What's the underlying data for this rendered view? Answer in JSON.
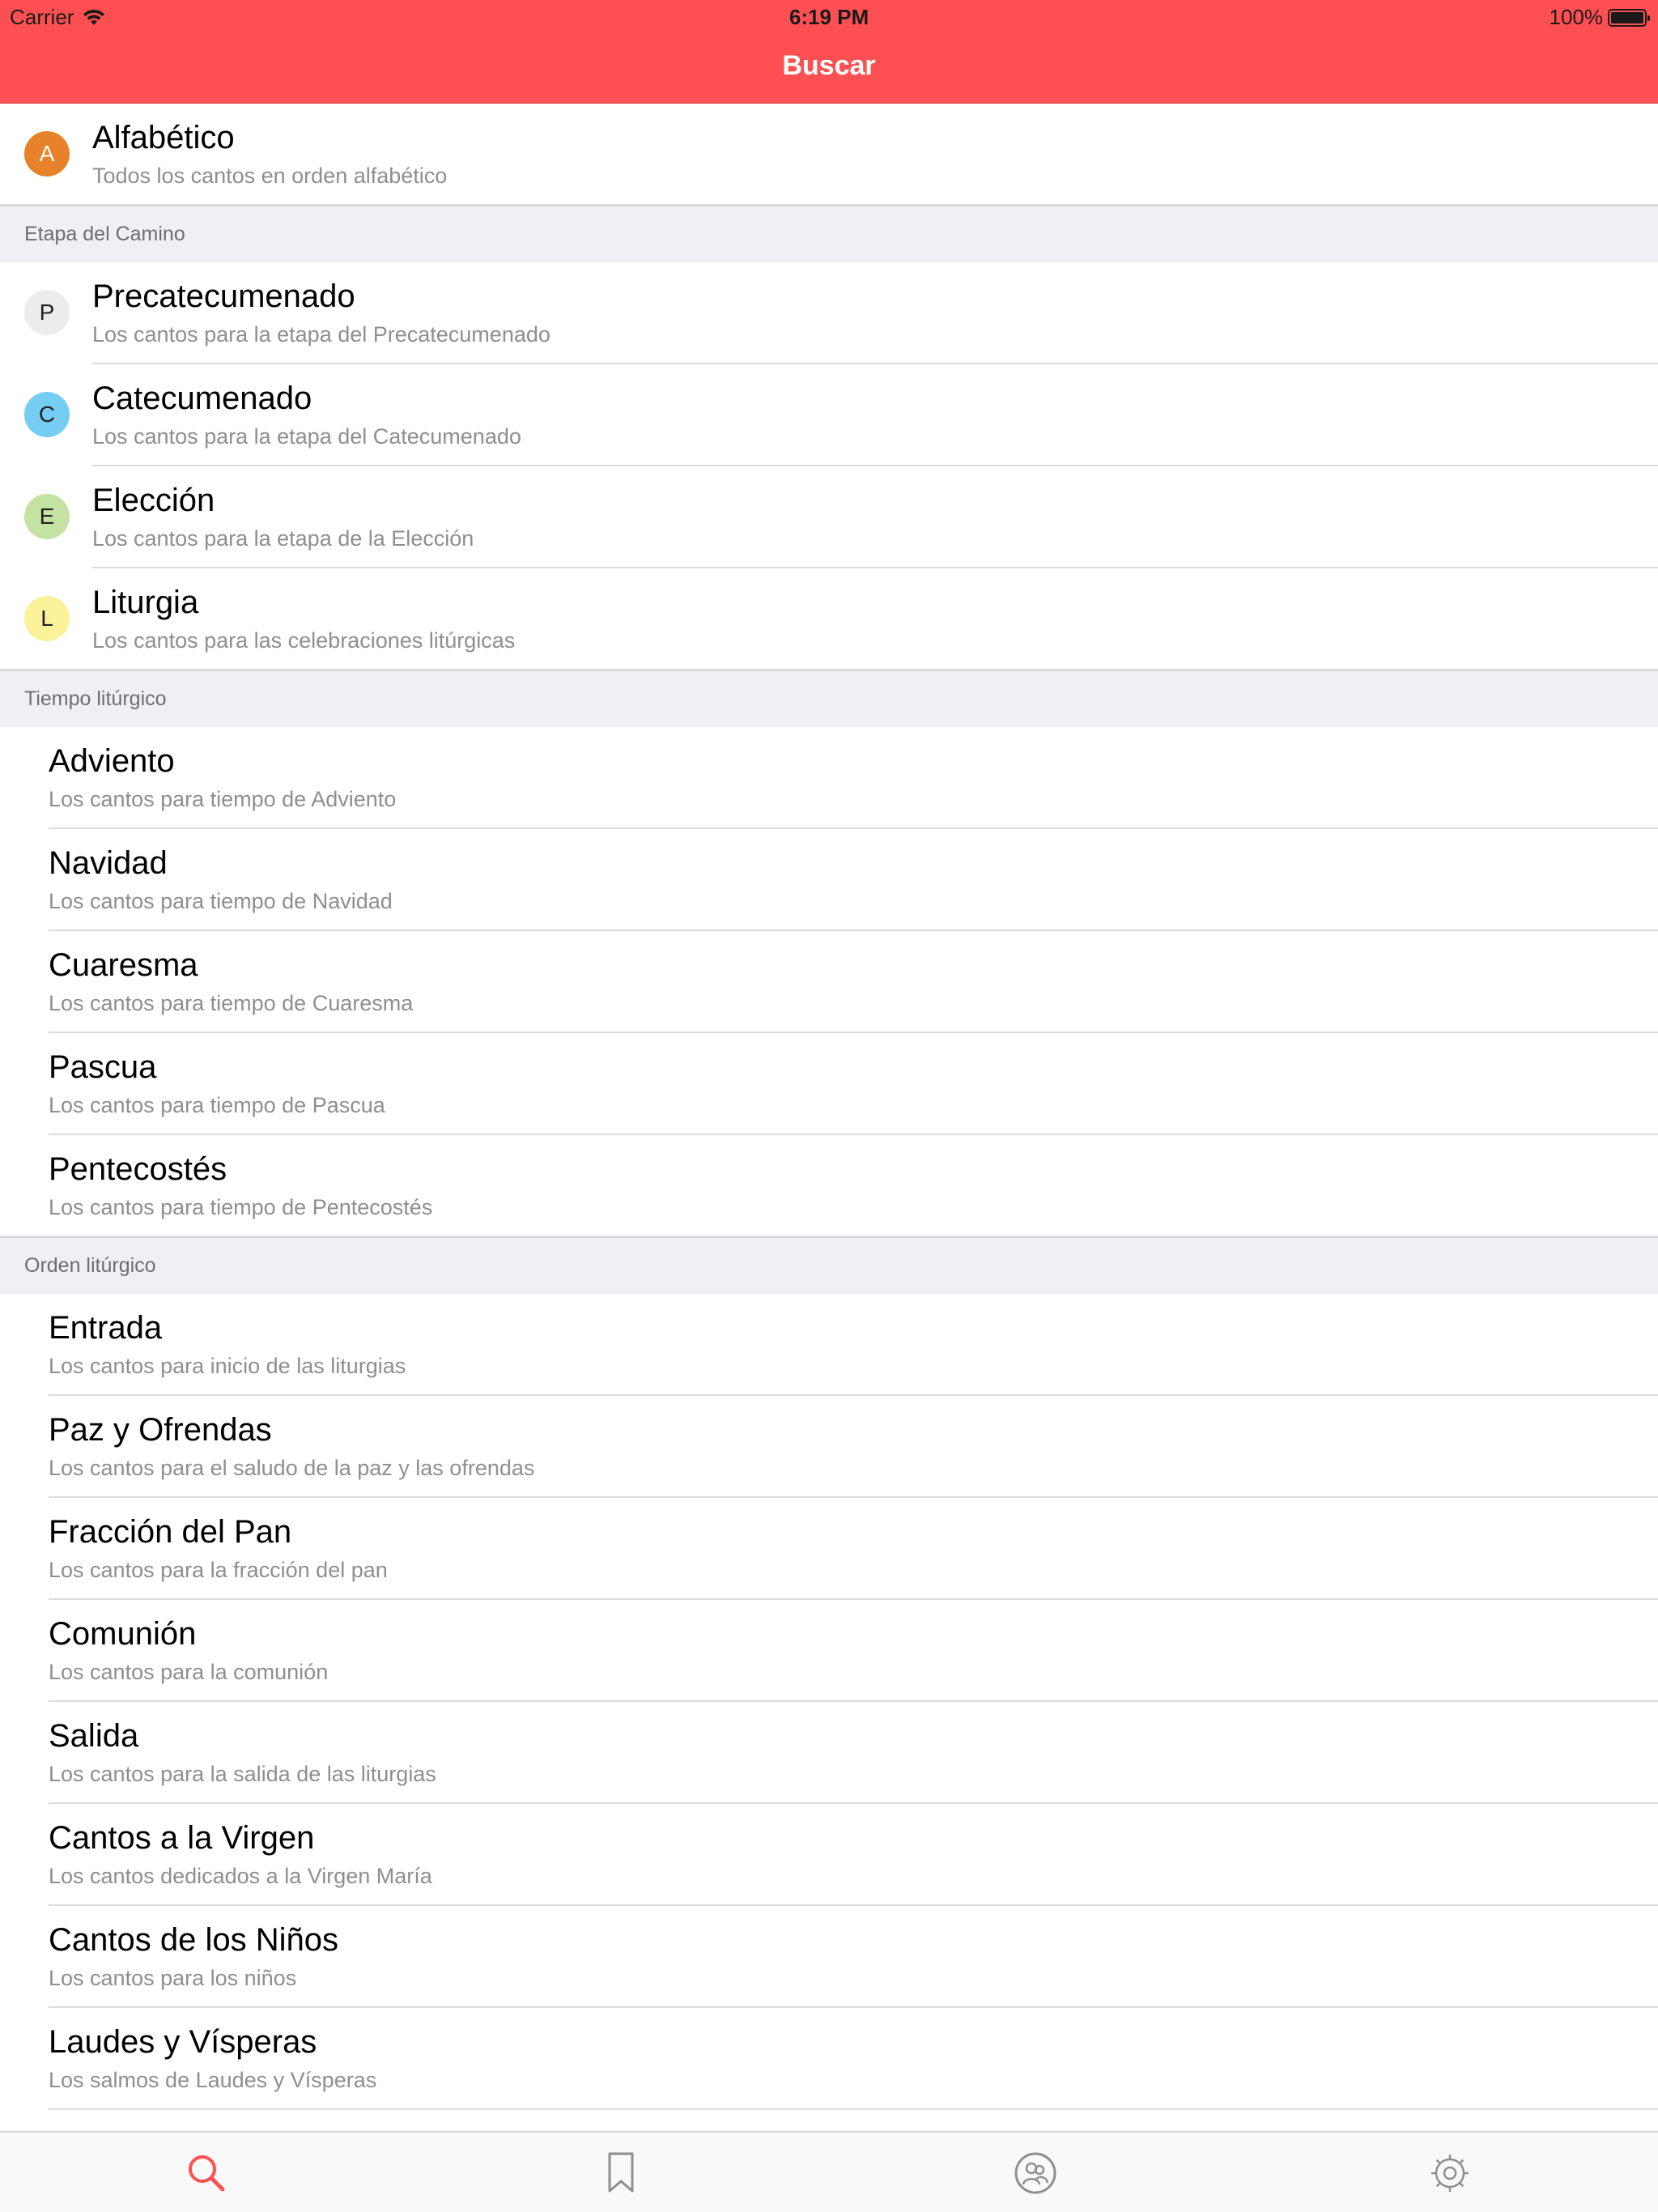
{
  "status_bar": {
    "carrier": "Carrier",
    "time": "6:19 PM",
    "battery": "100%"
  },
  "nav": {
    "title": "Buscar"
  },
  "colors": {
    "accent": "#fe5052",
    "badge_a": "#e8822a",
    "badge_p": "#ececec",
    "badge_c": "#76cdf3",
    "badge_e": "#c4e3a3",
    "badge_l": "#fcf29a",
    "section_bg": "#efeff4"
  },
  "alphabetical": {
    "badge": "A",
    "title": "Alfabético",
    "subtitle": "Todos los cantos en orden alfabético"
  },
  "etapa": {
    "header": "Etapa del Camino",
    "items": [
      {
        "badge": "P",
        "title": "Precatecumenado",
        "subtitle": "Los cantos para la etapa del Precatecumenado"
      },
      {
        "badge": "C",
        "title": "Catecumenado",
        "subtitle": "Los cantos para la etapa del Catecumenado"
      },
      {
        "badge": "E",
        "title": "Elección",
        "subtitle": "Los cantos para la etapa de la Elección"
      },
      {
        "badge": "L",
        "title": "Liturgia",
        "subtitle": "Los cantos para las celebraciones litúrgicas"
      }
    ]
  },
  "tiempo": {
    "header": "Tiempo litúrgico",
    "items": [
      {
        "title": "Adviento",
        "subtitle": "Los cantos para tiempo de Adviento"
      },
      {
        "title": "Navidad",
        "subtitle": "Los cantos para tiempo de Navidad"
      },
      {
        "title": "Cuaresma",
        "subtitle": "Los cantos para tiempo de Cuaresma"
      },
      {
        "title": "Pascua",
        "subtitle": "Los cantos para tiempo de Pascua"
      },
      {
        "title": "Pentecostés",
        "subtitle": "Los cantos para tiempo de Pentecostés"
      }
    ]
  },
  "orden": {
    "header": "Orden litúrgico",
    "items": [
      {
        "title": "Entrada",
        "subtitle": "Los cantos para inicio de las liturgias"
      },
      {
        "title": "Paz y Ofrendas",
        "subtitle": "Los cantos para el saludo de la paz y las ofrendas"
      },
      {
        "title": "Fracción del Pan",
        "subtitle": "Los cantos para la fracción del pan"
      },
      {
        "title": "Comunión",
        "subtitle": "Los cantos para la comunión"
      },
      {
        "title": "Salida",
        "subtitle": "Los cantos para la salida de las liturgias"
      },
      {
        "title": "Cantos a la Virgen",
        "subtitle": "Los cantos dedicados a la Virgen María"
      },
      {
        "title": "Cantos de los Niños",
        "subtitle": "Los cantos para los niños"
      },
      {
        "title": "Laudes y Vísperas",
        "subtitle": "Los salmos de Laudes y Vísperas"
      }
    ]
  },
  "tabs": [
    {
      "icon": "search-icon",
      "active": true
    },
    {
      "icon": "bookmark-icon",
      "active": false
    },
    {
      "icon": "community-icon",
      "active": false
    },
    {
      "icon": "gear-icon",
      "active": false
    }
  ]
}
